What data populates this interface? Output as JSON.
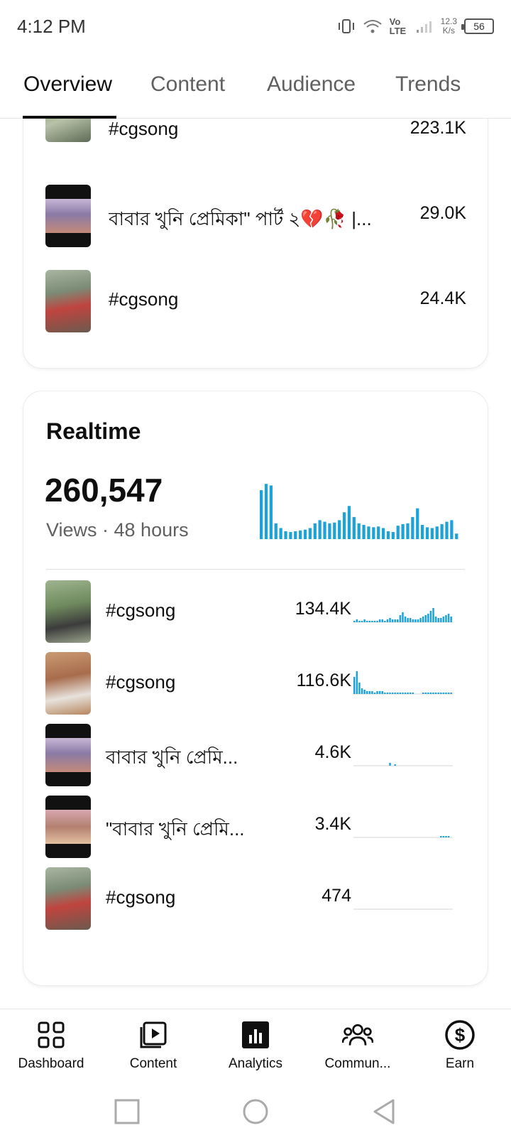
{
  "status_bar": {
    "time": "4:12 PM",
    "network": "Vo LTE",
    "speed_value": "12.3",
    "speed_unit": "K/s",
    "battery": "56"
  },
  "tabs": [
    {
      "label": "Overview",
      "active": true
    },
    {
      "label": "Content",
      "active": false
    },
    {
      "label": "Audience",
      "active": false
    },
    {
      "label": "Trends",
      "active": false
    }
  ],
  "top_content": {
    "rows": [
      {
        "title": "#cgsong",
        "value": "223.1K"
      },
      {
        "title": "বাবার খুনি প্রেমিকা\" পার্ট ২💔🥀 |...",
        "value": "29.0K"
      },
      {
        "title": "#cgsong",
        "value": "24.4K"
      }
    ]
  },
  "realtime": {
    "title": "Realtime",
    "count": "260,547",
    "subtitle": "Views · 48 hours",
    "accent_color": "#1ea3d8",
    "chart": [
      62,
      70,
      68,
      20,
      14,
      10,
      9,
      10,
      11,
      12,
      14,
      20,
      24,
      22,
      20,
      21,
      24,
      34,
      42,
      28,
      20,
      18,
      16,
      15,
      16,
      14,
      10,
      9,
      17,
      19,
      20,
      28,
      39,
      18,
      15,
      14,
      16,
      19,
      22,
      24,
      7
    ],
    "rows": [
      {
        "title": "#cgsong",
        "value": "134.4K",
        "spark": [
          1,
          2,
          1,
          1,
          2,
          1,
          1,
          1,
          1,
          1,
          2,
          2,
          1,
          2,
          3,
          2,
          2,
          2,
          5,
          7,
          4,
          3,
          3,
          2,
          2,
          2,
          3,
          4,
          5,
          6,
          8,
          10,
          4,
          3,
          3,
          4,
          5,
          6,
          4
        ]
      },
      {
        "title": "#cgsong",
        "value": "116.6K",
        "spark": [
          12,
          16,
          8,
          4,
          3,
          2,
          2,
          2,
          1,
          2,
          2,
          2,
          1,
          1,
          1,
          1,
          1,
          1,
          1,
          1,
          1,
          1,
          1,
          1,
          0,
          0,
          0,
          1,
          1,
          1,
          1,
          1,
          1,
          1,
          1,
          1,
          1,
          1,
          1
        ]
      },
      {
        "title": "বাবার খুনি প্রেমি...",
        "value": "4.6K",
        "spark": [
          0,
          0,
          0,
          0,
          0,
          0,
          0,
          0,
          0,
          0,
          0,
          0,
          0,
          0,
          2,
          0,
          1,
          0,
          0,
          0,
          0,
          0,
          0,
          0,
          0,
          0,
          0,
          0,
          0,
          0,
          0,
          0,
          0,
          0,
          0,
          0,
          0,
          0,
          0
        ]
      },
      {
        "title": "\"বাবার খুনি প্রেমি...",
        "value": "3.4K",
        "spark": [
          0,
          0,
          0,
          0,
          0,
          0,
          0,
          0,
          0,
          0,
          0,
          0,
          0,
          0,
          0,
          0,
          0,
          0,
          0,
          0,
          0,
          0,
          0,
          0,
          0,
          0,
          0,
          0,
          0,
          0,
          0,
          0,
          0,
          0,
          1,
          1,
          1,
          1,
          0
        ]
      },
      {
        "title": "#cgsong",
        "value": "474",
        "spark": [
          0,
          0,
          0,
          0,
          0,
          0,
          0,
          0,
          0,
          0,
          0,
          0,
          0,
          0,
          0,
          0,
          0,
          0,
          0,
          0,
          0,
          0,
          0,
          0,
          0,
          0,
          0,
          0,
          0,
          0,
          0,
          0,
          0,
          0,
          0,
          0,
          0,
          0,
          0
        ]
      }
    ]
  },
  "bottom_nav": [
    {
      "label": "Dashboard",
      "icon": "dashboard-icon"
    },
    {
      "label": "Content",
      "icon": "content-icon"
    },
    {
      "label": "Analytics",
      "icon": "analytics-icon",
      "active": true
    },
    {
      "label": "Commun...",
      "icon": "community-icon"
    },
    {
      "label": "Earn",
      "icon": "earn-icon"
    }
  ]
}
